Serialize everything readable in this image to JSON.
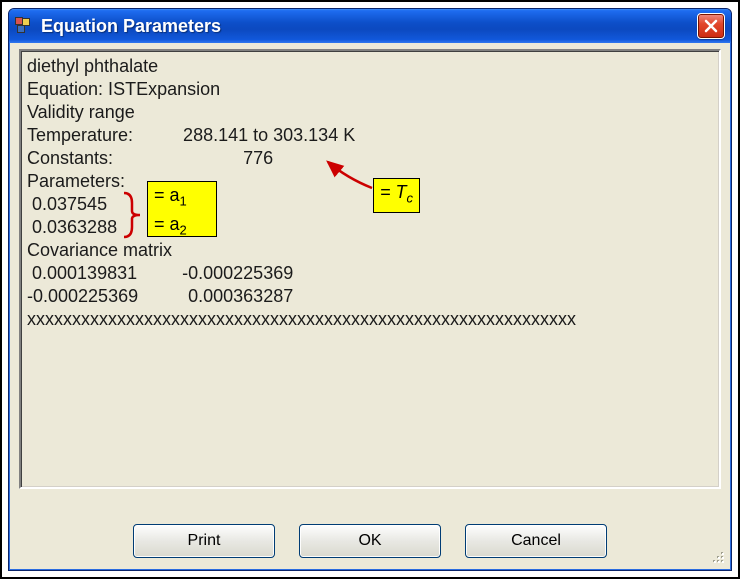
{
  "window": {
    "title": "Equation Parameters"
  },
  "panel": {
    "compound": "diethyl phthalate",
    "equation_line": "Equation: ISTExpansion",
    "validity_heading": "Validity range",
    "temperature_line": "Temperature:          288.141 to 303.134 K",
    "constants_line": "Constants:                          776",
    "parameters_heading": "Parameters:",
    "param1": " 0.037545",
    "param2": " 0.0363288",
    "covariance_heading": "Covariance matrix",
    "cov_row1": " 0.000139831         -0.000225369",
    "cov_row2": "-0.000225369          0.000363287",
    "separator": "xxxxxxxxxxxxxxxxxxxxxxxxxxxxxxxxxxxxxxxxxxxxxxxxxxxxxxxxxxxxx"
  },
  "annotations": {
    "a1": "= a",
    "a1_sub": "1",
    "a2": "= a",
    "a2_sub": "2",
    "tc_prefix": "= ",
    "tc_main": "T",
    "tc_sub": "c"
  },
  "buttons": {
    "print": "Print",
    "ok": "OK",
    "cancel": "Cancel"
  }
}
